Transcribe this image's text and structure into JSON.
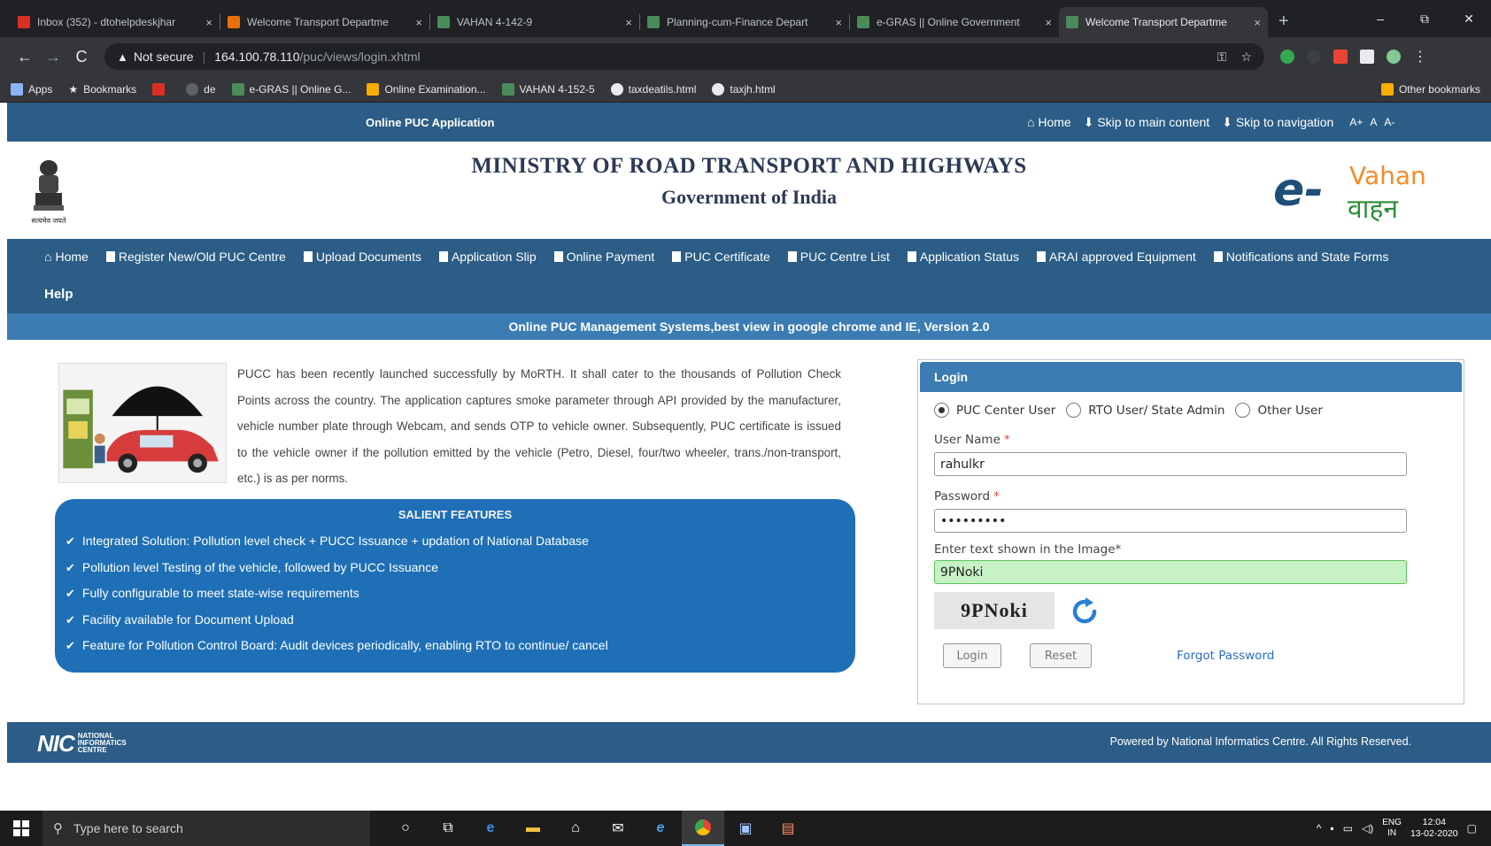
{
  "browser": {
    "tabs": [
      {
        "title": "Inbox (352) - dtohelpdeskjhar",
        "icon": "gmail-icon",
        "color": "#d93025"
      },
      {
        "title": "Welcome Transport Departme",
        "icon": "site-icon",
        "color": "#e8710a"
      },
      {
        "title": "VAHAN 4-142-9",
        "icon": "vahan-icon",
        "color": "#4a8b5a"
      },
      {
        "title": "Planning-cum-Finance Depart",
        "icon": "site-icon",
        "color": "#4a8b5a"
      },
      {
        "title": "e-GRAS || Online Government",
        "icon": "site-icon",
        "color": "#4a8b5a"
      },
      {
        "title": "Welcome Transport Departme",
        "icon": "site-icon",
        "color": "#4a8b5a"
      }
    ],
    "tab_close": "×",
    "new_tab": "+",
    "window_controls": {
      "minimize": "–",
      "maximize": "⧉",
      "close": "✕"
    },
    "address": {
      "security": "Not secure",
      "host": "164.100.78.110",
      "path": "/puc/views/login.xhtml"
    },
    "bookmarks": [
      {
        "label": "Apps",
        "color": "#8ab4f8"
      },
      {
        "label": "Bookmarks",
        "color": "#e8eaed"
      },
      {
        "label": "",
        "color": "#d93025"
      },
      {
        "label": "de",
        "color": "#9aa0a6"
      },
      {
        "label": "e-GRAS || Online G...",
        "color": "#4a8b5a"
      },
      {
        "label": "Online Examination...",
        "color": "#f9ab00"
      },
      {
        "label": "VAHAN 4-152-5",
        "color": "#4a8b5a"
      },
      {
        "label": "taxdeatils.html",
        "color": "#e8eaed"
      },
      {
        "label": "taxjh.html",
        "color": "#e8eaed"
      }
    ],
    "other_bookmarks": "Other bookmarks"
  },
  "site": {
    "top_bar": {
      "app_name": "Online PUC Application",
      "home": "Home",
      "skip_main": "Skip to main content",
      "skip_nav": "Skip to navigation",
      "font_large": "A+",
      "font_normal": "A",
      "font_small": "A-"
    },
    "header": {
      "emblem_caption": "सत्यमेव जयते",
      "title_line1": "MINISTRY OF ROAD TRANSPORT AND HIGHWAYS",
      "title_line2": "Government of India",
      "logo_e": "e-",
      "logo_vahan": "Vahan",
      "logo_hindi": "वाहन"
    },
    "nav": {
      "items": [
        "Home",
        "Register New/Old PUC Centre",
        "Upload Documents",
        "Application Slip",
        "Online Payment",
        "PUC Certificate",
        "PUC Centre List",
        "Application Status",
        "ARAI approved Equipment",
        "Notifications and State Forms"
      ],
      "help": "Help"
    },
    "notice": "Online PUC Management Systems,best view in google chrome and IE, Version 2.0",
    "intro": "PUCC has been recently launched successfully by MoRTH. It shall cater to the thousands of Pollution Check Points across the country. The application captures smoke parameter through API provided by the manufacturer, vehicle number plate through Webcam, and sends OTP to vehicle owner. Subsequently, PUC certificate is issued to the vehicle owner if the pollution emitted by the vehicle (Petro, Diesel, four/two wheeler, trans./non-transport, etc.) is as per norms.",
    "features": {
      "title": "SALIENT FEATURES",
      "items": [
        "Integrated Solution: Pollution level check + PUCC Issuance + updation of National Database",
        "Pollution level Testing of the vehicle, followed by PUCC Issuance",
        "Fully configurable to meet state-wise requirements",
        "Facility available for Document Upload",
        "Feature for Pollution Control Board: Audit devices periodically, enabling RTO to continue/ cancel"
      ]
    },
    "login": {
      "heading": "Login",
      "roles": [
        "PUC Center User",
        "RTO User/ State Admin",
        "Other User"
      ],
      "selected_role": 0,
      "username_label": "User Name",
      "username_value": "rahulkr",
      "password_label": "Password",
      "password_value": "•••••••••",
      "captcha_label": "Enter text shown in the Image*",
      "captcha_value": "9PNoki",
      "captcha_image_text": "9PNoki",
      "required_mark": "*",
      "login_button": "Login",
      "reset_button": "Reset",
      "forgot_link": "Forgot Password"
    },
    "footer": {
      "nic": "NIC",
      "nic_sub1": "NATIONAL",
      "nic_sub2": "INFORMATICS",
      "nic_sub3": "CENTRE",
      "powered": "Powered by National Informatics Centre. All Rights Reserved."
    }
  },
  "taskbar": {
    "search_placeholder": "Type here to search",
    "lang_top": "ENG",
    "lang_bottom": "IN",
    "time": "12:04",
    "date": "13-02-2020"
  },
  "colors": {
    "site_blue": "#2b5d86",
    "notice_blue": "#3b7cb2",
    "features_blue": "#1e6fb6",
    "captcha_green": "#c6f2c6"
  }
}
